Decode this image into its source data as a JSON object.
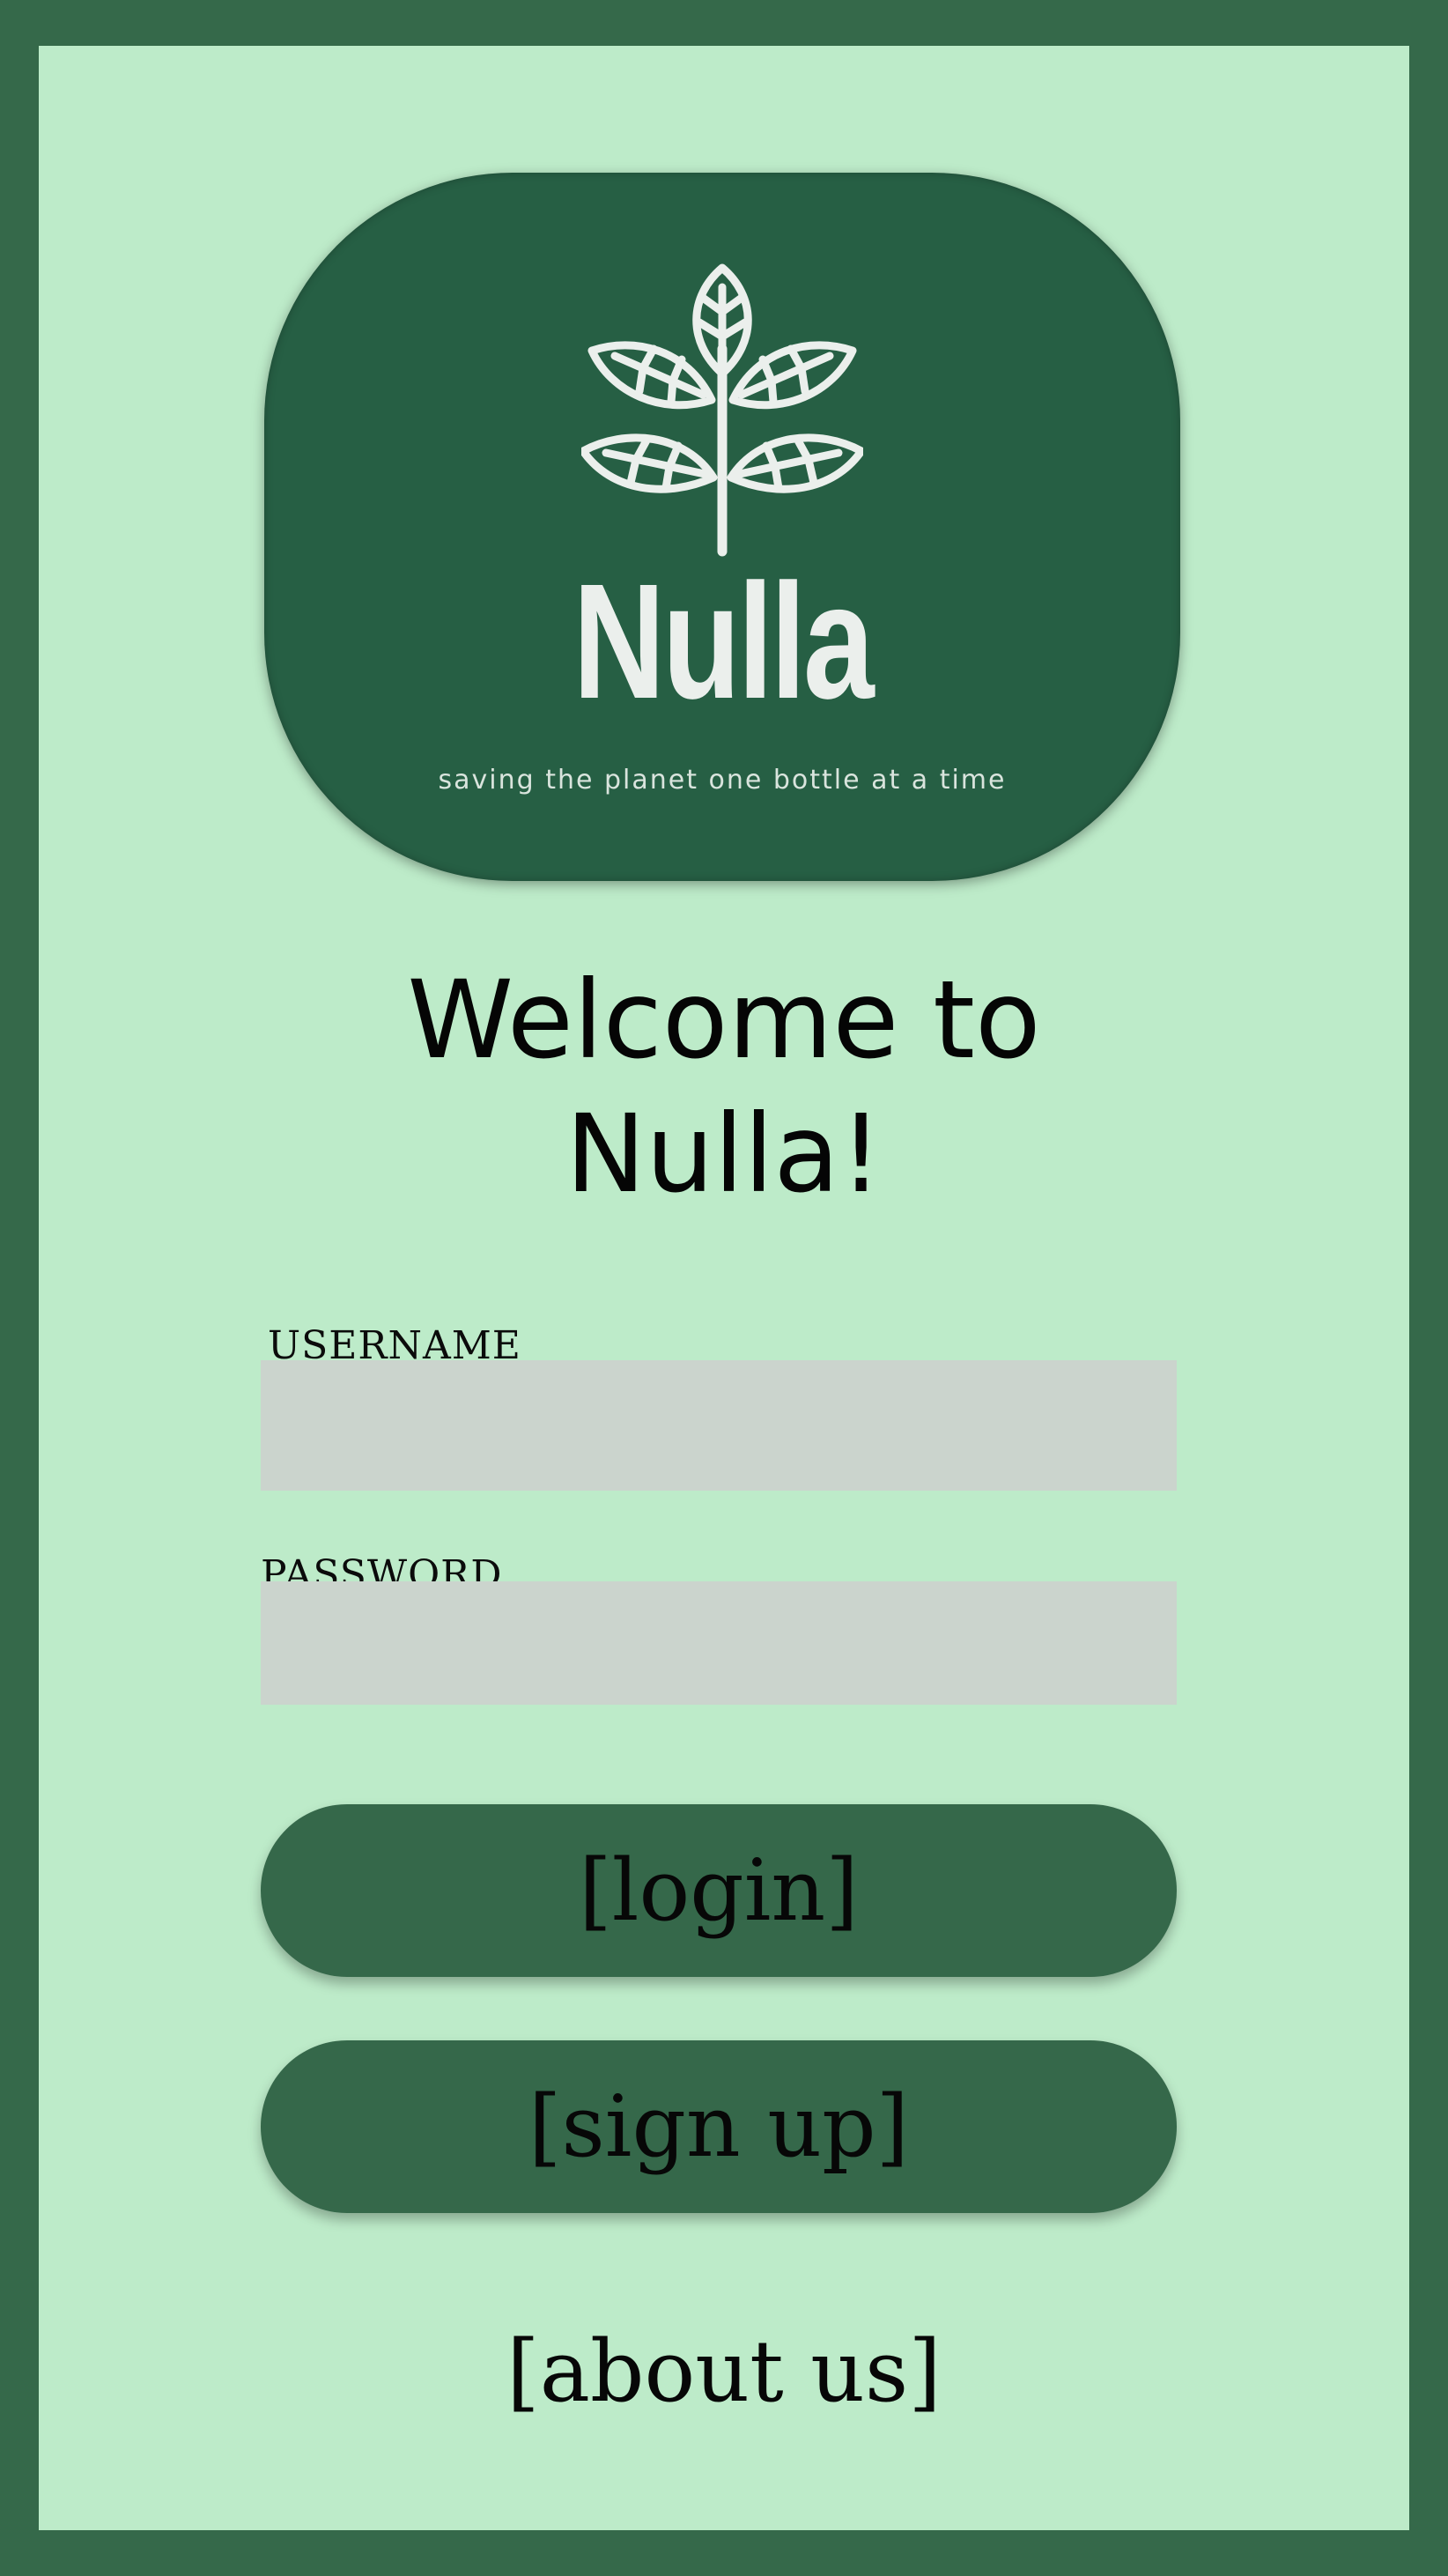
{
  "brand": {
    "logo_icon": "leaf-branch-icon",
    "name": "Nulla",
    "tagline": "saving the planet one bottle at a time"
  },
  "welcome": {
    "line1": "Welcome to",
    "line2": "Nulla!"
  },
  "form": {
    "username_label": "USERNAME",
    "username_value": "",
    "password_label": "PASSWORD",
    "password_value": ""
  },
  "actions": {
    "login_label": "[login]",
    "signup_label": "[sign up]",
    "about_label": "[about us]"
  },
  "colors": {
    "outer_frame": "#35694a",
    "panel_background": "#bdebc9",
    "logo_card": "#265f44",
    "button": "#35684a",
    "input_background": "#cbd4cd",
    "logo_foreground": "#ebefec"
  }
}
